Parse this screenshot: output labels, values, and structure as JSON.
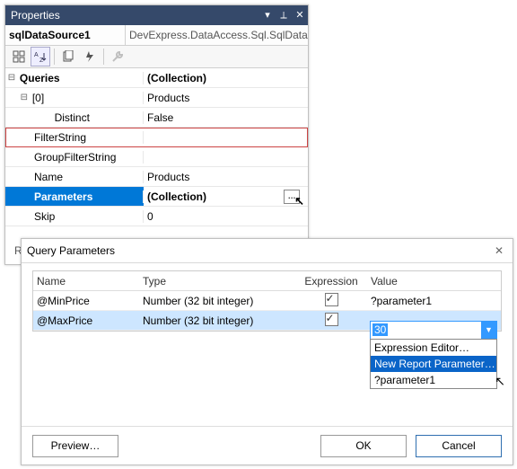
{
  "properties": {
    "title": "Properties",
    "object_name": "sqlDataSource1",
    "object_type": "DevExpress.DataAccess.Sql.SqlDataSource",
    "rows": {
      "queries": {
        "label": "Queries",
        "value": "(Collection)"
      },
      "index0": {
        "label": "[0]",
        "value": "Products"
      },
      "distinct": {
        "label": "Distinct",
        "value": "False"
      },
      "filterstring": {
        "label": "FilterString",
        "value": ""
      },
      "groupfilterstring": {
        "label": "GroupFilterString",
        "value": ""
      },
      "name": {
        "label": "Name",
        "value": "Products"
      },
      "parameters": {
        "label": "Parameters",
        "value": "(Collection)"
      },
      "skip": {
        "label": "Skip",
        "value": "0"
      }
    },
    "footer_char": "R"
  },
  "query_dialog": {
    "title": "Query Parameters",
    "columns": {
      "name": "Name",
      "type": "Type",
      "expression": "Expression",
      "value": "Value"
    },
    "rows": [
      {
        "name": "@MinPrice",
        "type": "Number (32 bit integer)",
        "expression": true,
        "value": "?parameter1"
      },
      {
        "name": "@MaxPrice",
        "type": "Number (32 bit integer)",
        "expression": true,
        "value": "30"
      }
    ],
    "dropdown": {
      "items": [
        "Expression Editor…",
        "New Report Parameter…",
        "?parameter1"
      ],
      "highlighted_index": 1
    },
    "buttons": {
      "preview": "Preview…",
      "ok": "OK",
      "cancel": "Cancel"
    }
  }
}
